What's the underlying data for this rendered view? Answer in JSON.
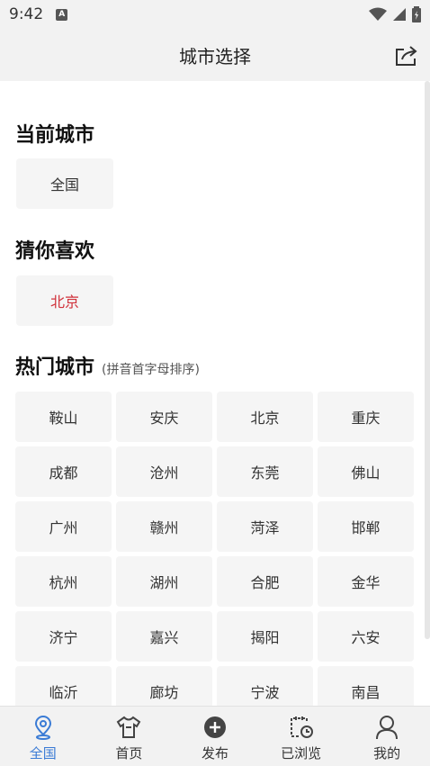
{
  "status_bar": {
    "time": "9:42",
    "notification_letter": "A"
  },
  "nav": {
    "title": "城市选择"
  },
  "current_city": {
    "title": "当前城市",
    "value": "全国"
  },
  "guess": {
    "title": "猜你喜欢",
    "value": "北京"
  },
  "hot": {
    "title": "热门城市",
    "subtitle": "(拼音首字母排序)",
    "cities": [
      "鞍山",
      "安庆",
      "北京",
      "重庆",
      "成都",
      "沧州",
      "东莞",
      "佛山",
      "广州",
      "赣州",
      "菏泽",
      "邯郸",
      "杭州",
      "湖州",
      "合肥",
      "金华",
      "济宁",
      "嘉兴",
      "揭阳",
      "六安",
      "临沂",
      "廊坊",
      "宁波",
      "南昌"
    ]
  },
  "tabs": [
    {
      "label": "全国",
      "icon": "location-pin-icon",
      "active": true
    },
    {
      "label": "首页",
      "icon": "shirt-icon",
      "active": false
    },
    {
      "label": "发布",
      "icon": "plus-circle-icon",
      "active": false
    },
    {
      "label": "已浏览",
      "icon": "history-calendar-icon",
      "active": false
    },
    {
      "label": "我的",
      "icon": "user-icon",
      "active": false
    }
  ],
  "colors": {
    "accent": "#3a7bd5",
    "highlight_red": "#d0313a",
    "chip_bg": "#f5f5f5",
    "bar_bg": "#f2f2f2"
  }
}
